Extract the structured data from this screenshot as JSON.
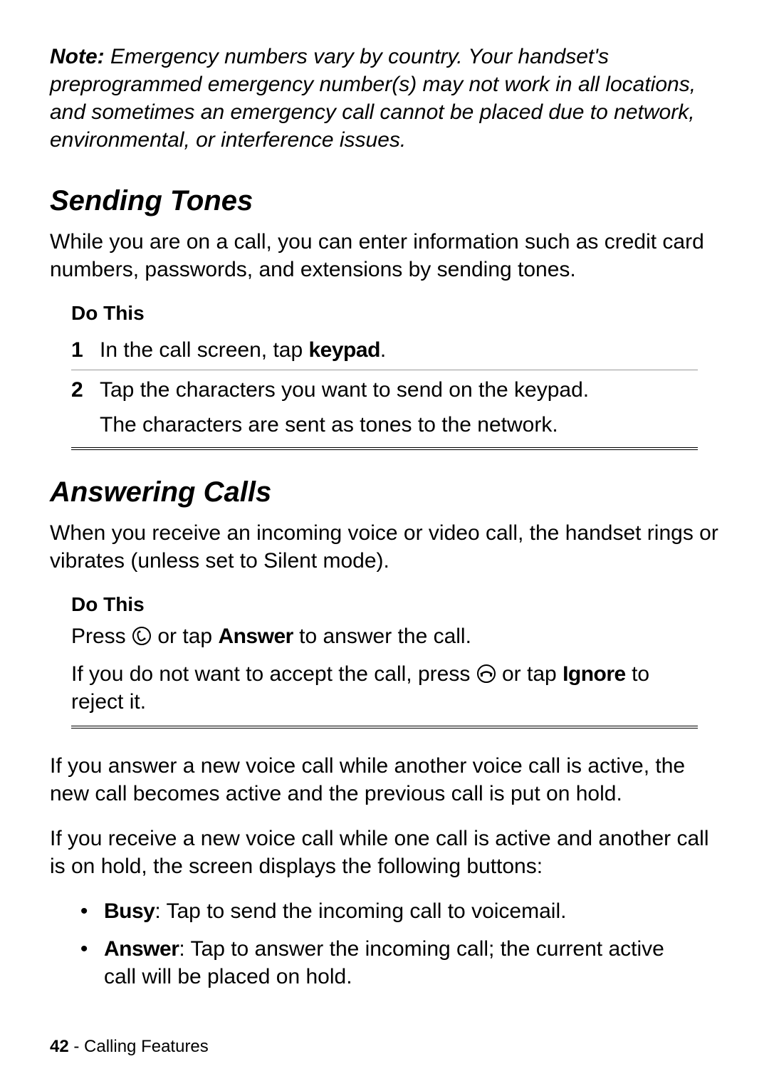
{
  "note": {
    "label": "Note:",
    "text": "Emergency numbers vary by country. Your handset's preprogrammed emergency number(s) may not work in all locations, and sometimes an emergency call cannot be placed due to network, environmental, or interference issues."
  },
  "sending_tones": {
    "heading": "Sending Tones",
    "intro": "While you are on a call, you can enter information such as credit card numbers, passwords, and extensions by sending tones.",
    "do_this": "Do This",
    "step1_num": "1",
    "step1_a": "In the call screen, tap ",
    "step1_b": "keypad",
    "step1_c": ".",
    "step2_num": "2",
    "step2_line1": "Tap the characters you want to send on the keypad.",
    "step2_line2": "The characters are sent as tones to the network."
  },
  "answering_calls": {
    "heading": "Answering Calls",
    "intro": "When you receive an incoming voice or video call, the handset rings or vibrates (unless set to Silent mode).",
    "do_this": "Do This",
    "line1_a": "Press ",
    "line1_b": " or tap ",
    "line1_c": "Answer",
    "line1_d": " to answer the call.",
    "line2_a": "If you do not want to accept the call, press ",
    "line2_b": " or tap ",
    "line2_c": "Ignore",
    "line2_d": " to reject it.",
    "para1": "If you answer a new voice call while another voice call is active, the new call becomes active and the previous call is put on hold.",
    "para2": "If you receive a new voice call while one call is active and another call is on hold, the screen displays the following buttons:",
    "bullet1_a": "Busy",
    "bullet1_b": ": Tap to send the incoming call to voicemail.",
    "bullet2_a": "Answer",
    "bullet2_b": ": Tap to answer the incoming call; the current active call will be placed on hold."
  },
  "footer": {
    "page": "42",
    "sep": " - ",
    "section": "Calling Features"
  }
}
